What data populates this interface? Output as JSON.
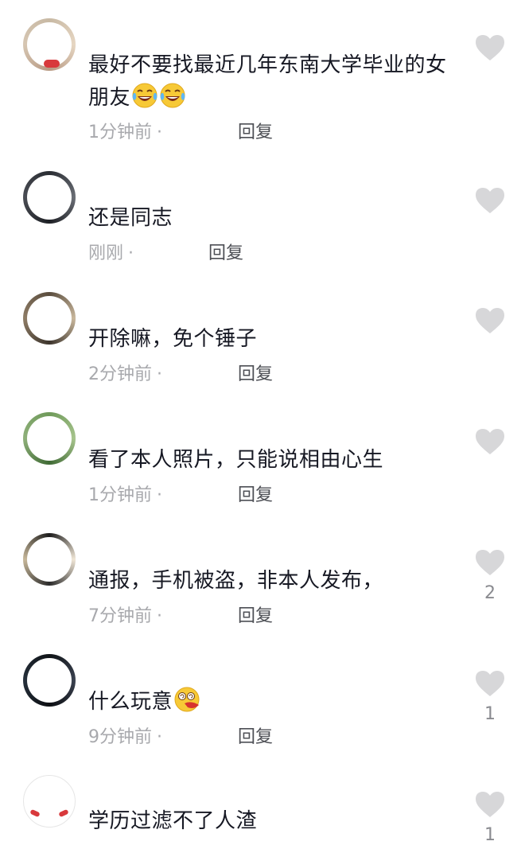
{
  "comments": [
    {
      "text": "最好不要找最近几年东南大学毕业的女朋友",
      "emoji": [
        "laughing-crying-emoji",
        "laughing-crying-emoji"
      ],
      "time": "1分钟前",
      "dot": "·",
      "reply": "回复",
      "likes": ""
    },
    {
      "text": "还是同志",
      "time": "刚刚",
      "dot": "·",
      "reply": "回复",
      "likes": ""
    },
    {
      "text": "开除嘛，免个锤子",
      "time": "2分钟前",
      "dot": "·",
      "reply": "回复",
      "likes": ""
    },
    {
      "text": "看了本人照片，只能说相由心生",
      "time": "1分钟前",
      "dot": "·",
      "reply": "回复",
      "likes": ""
    },
    {
      "text": "通报，手机被盗，非本人发布，",
      "time": "7分钟前",
      "dot": "·",
      "reply": "回复",
      "likes": "2"
    },
    {
      "text": "什么玩意",
      "emoji": [
        "dizzy-vomit-emoji"
      ],
      "time": "9分钟前",
      "dot": "·",
      "reply": "回复",
      "likes": "1"
    },
    {
      "text": "学历过滤不了人渣",
      "time": "",
      "dot": "",
      "reply": "",
      "likes": "1"
    }
  ],
  "colors": {
    "text": "#161823",
    "meta": "#a8a9ad",
    "reply": "#4d4f55",
    "heart": "#d7d7d9"
  }
}
